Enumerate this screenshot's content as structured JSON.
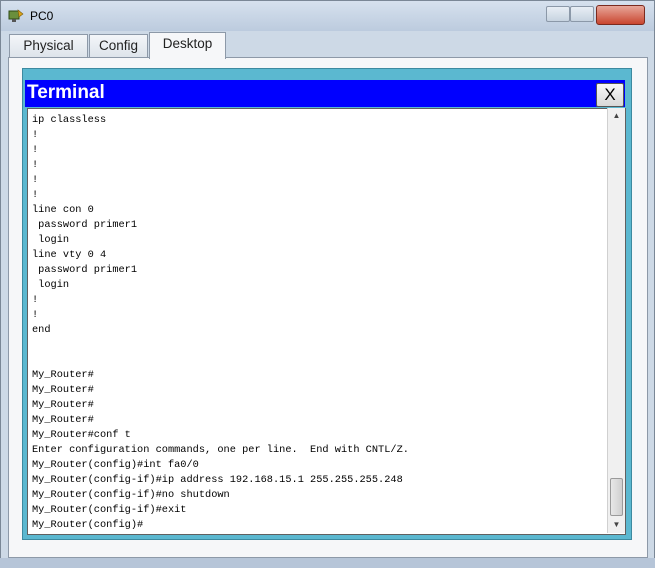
{
  "window": {
    "title": "PC0"
  },
  "tabs": [
    {
      "label": "Physical"
    },
    {
      "label": "Config"
    },
    {
      "label": "Desktop"
    }
  ],
  "terminal": {
    "title": "Terminal",
    "close_label": "X",
    "lines": [
      "ip classless",
      "!",
      "!",
      "!",
      "!",
      "!",
      "line con 0",
      " password primer1",
      " login",
      "line vty 0 4",
      " password primer1",
      " login",
      "!",
      "!",
      "end",
      "",
      "",
      "My_Router#",
      "My_Router#",
      "My_Router#",
      "My_Router#",
      "My_Router#conf t",
      "Enter configuration commands, one per line.  End with CNTL/Z.",
      "My_Router(config)#int fa0/0",
      "My_Router(config-if)#ip address 192.168.15.1 255.255.255.248",
      "My_Router(config-if)#no shutdown",
      "My_Router(config-if)#exit",
      "My_Router(config)#"
    ]
  },
  "icons": {
    "app": "packet-tracer-pc-icon",
    "scroll_up": "arrow-up-icon",
    "scroll_down": "arrow-down-icon"
  },
  "colors": {
    "terminal_header": "#0000ff",
    "terminal_frame": "#5bb8d0",
    "close_button": "#c9462f"
  }
}
